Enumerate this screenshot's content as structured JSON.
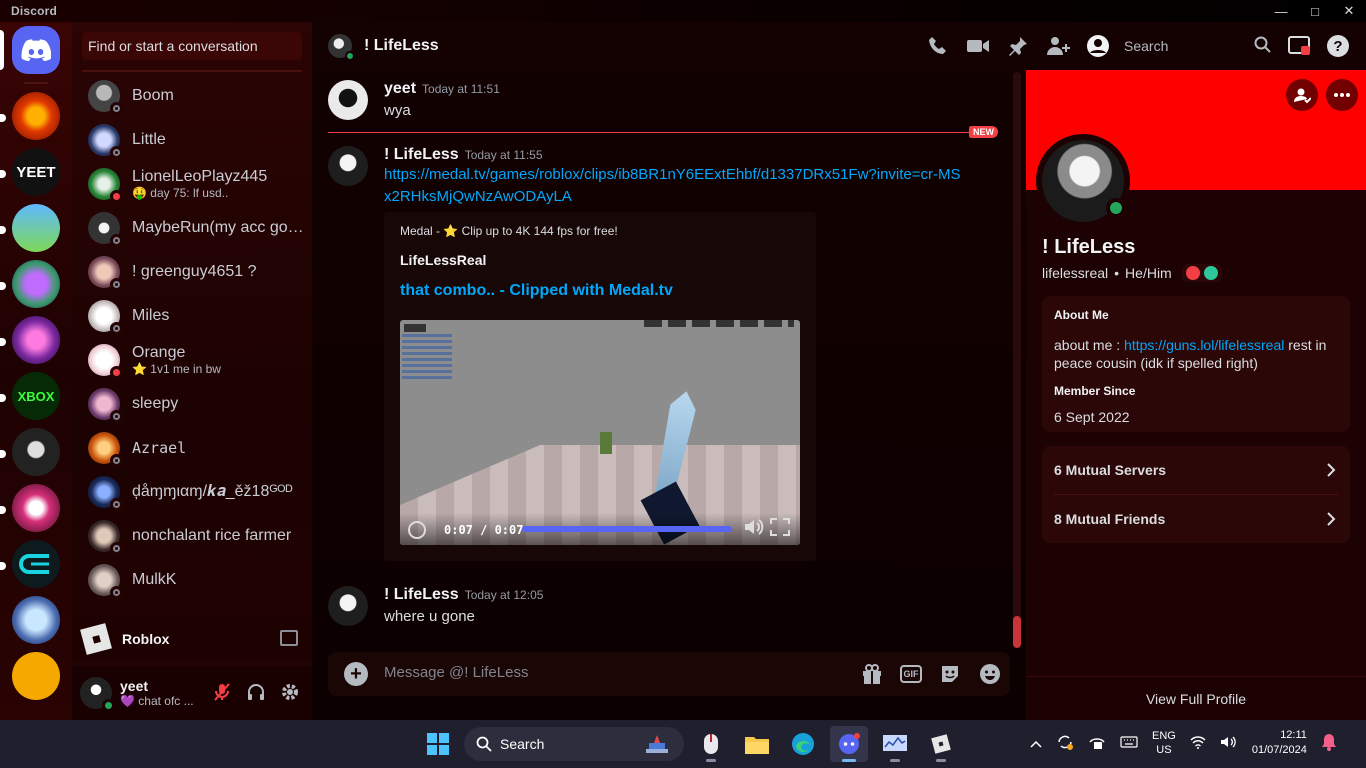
{
  "window": {
    "app_name": "Discord"
  },
  "dm_sidebar": {
    "search_placeholder": "Find or start a conversation",
    "items": [
      {
        "name": "Boom",
        "status": "offline",
        "subtitle": ""
      },
      {
        "name": "Little",
        "status": "offline",
        "subtitle": ""
      },
      {
        "name": "LionelLeoPlayz445",
        "status": "dnd",
        "subtitle": "🤑 day 75: lf usd.."
      },
      {
        "name": "MaybeRun(my acc got...",
        "status": "offline",
        "subtitle": ""
      },
      {
        "name": "! greenguy4651 ?",
        "status": "offline",
        "subtitle": ""
      },
      {
        "name": "Miles",
        "status": "offline",
        "subtitle": ""
      },
      {
        "name": "Orange",
        "status": "dnd",
        "subtitle": "⭐ 1v1 me in bw"
      },
      {
        "name": "sleepy",
        "status": "offline",
        "subtitle": ""
      },
      {
        "name": "Azrael",
        "status": "offline",
        "subtitle": ""
      },
      {
        "name": "ḑåɱɱιαɱ/𝒌𝒂_ěž18ᴳᴼᴰ",
        "status": "offline",
        "subtitle": ""
      },
      {
        "name": "nonchalant rice farmer",
        "status": "offline",
        "subtitle": ""
      },
      {
        "name": "MulkK",
        "status": "offline",
        "subtitle": ""
      }
    ],
    "activity": {
      "label": "Roblox"
    },
    "user": {
      "name": "yeet",
      "status_text": "💜 chat ofc ..."
    }
  },
  "chat": {
    "header": {
      "title": "! LifeLess",
      "search_placeholder": "Search"
    },
    "new_badge": "NEW",
    "messages": [
      {
        "author": "yeet",
        "time": "Today at 11:51",
        "text": "wya"
      },
      {
        "author": "! LifeLess",
        "time": "Today at 11:55",
        "link": "https://medal.tv/games/roblox/clips/ib8BR1nY6EExtEhbf/d1337DRx51Fw?invite=cr-MSx2RHksMjQwNzAwODAyLA",
        "embed": {
          "provider": "Medal - ⭐ Clip up to 4K 144 fps for free!",
          "author": "LifeLessReal",
          "title": "that combo.. - Clipped with Medal.tv",
          "video_time": "0:07 / 0:07",
          "video_progress": 1.0
        }
      },
      {
        "author": "! LifeLess",
        "time": "Today at 12:05",
        "text": "where u gone"
      }
    ],
    "composer_placeholder": "Message @! LifeLess",
    "gif_label": "GIF"
  },
  "profile": {
    "display_name": "! LifeLess",
    "username": "lifelessreal",
    "pronouns": "He/Him",
    "about_heading": "About Me",
    "about_prefix": "about me : ",
    "about_link": "https://guns.lol/lifelessreal",
    "about_suffix": " rest in peace cousin (idk if spelled right)",
    "member_since_heading": "Member Since",
    "member_since": "6 Sept 2022",
    "mutual_servers": "6 Mutual Servers",
    "mutual_friends": "8 Mutual Friends",
    "view_full": "View Full Profile",
    "banner_color": "#fe0000"
  },
  "taskbar": {
    "search_label": "Search",
    "lang_top": "ENG",
    "lang_bottom": "US",
    "time": "12:11",
    "date": "01/07/2024"
  }
}
